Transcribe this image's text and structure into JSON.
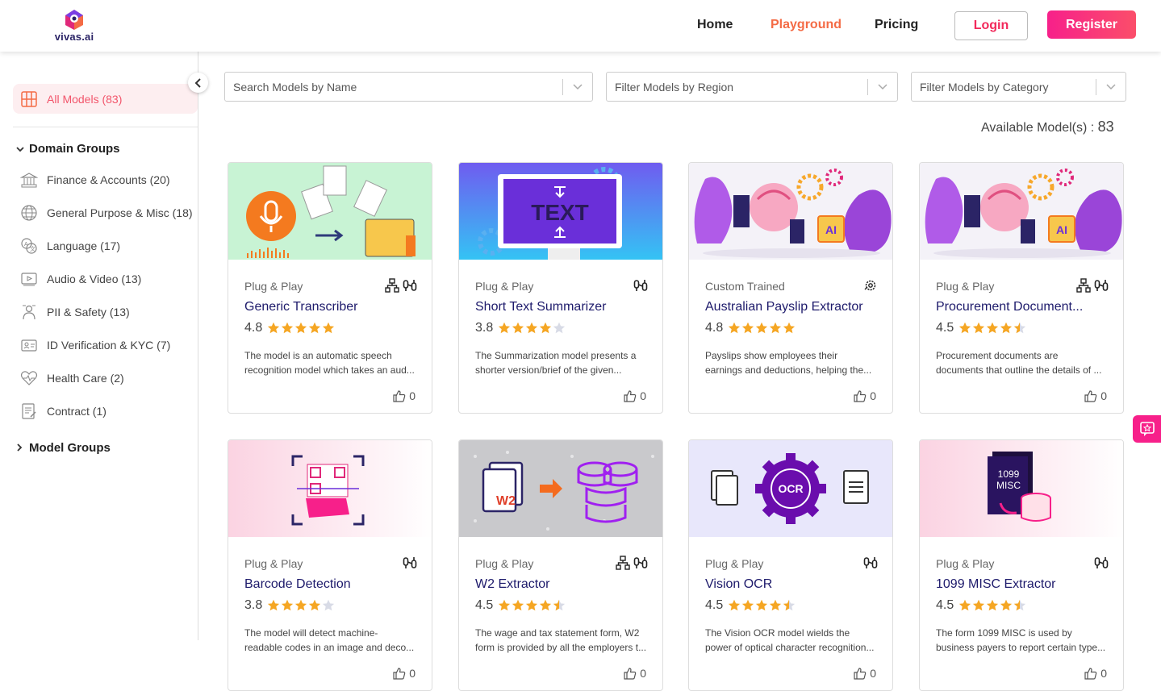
{
  "header": {
    "logo_text": "vivas.ai",
    "nav": [
      "Home",
      "Playground",
      "Pricing"
    ],
    "active_nav": "Playground",
    "login_label": "Login",
    "register_label": "Register"
  },
  "sidebar": {
    "all_models_label": "All Models (83)",
    "domain_groups_label": "Domain Groups",
    "model_groups_label": "Model Groups",
    "items": [
      {
        "label": "Finance & Accounts (20)",
        "icon": "bank-icon"
      },
      {
        "label": "General Purpose & Misc (18)",
        "icon": "globe-icon"
      },
      {
        "label": "Language (17)",
        "icon": "translate-icon"
      },
      {
        "label": "Audio & Video (13)",
        "icon": "video-icon"
      },
      {
        "label": "PII & Safety (13)",
        "icon": "shield-person-icon"
      },
      {
        "label": "ID Verification & KYC (7)",
        "icon": "id-card-icon"
      },
      {
        "label": "Health Care (2)",
        "icon": "heartbeat-icon"
      },
      {
        "label": "Contract (1)",
        "icon": "contract-icon"
      }
    ]
  },
  "filters": {
    "name_placeholder": "Search Models by Name",
    "region_placeholder": "Filter Models by Region",
    "category_placeholder": "Filter Models by Category"
  },
  "available": {
    "label": "Available Model(s) :",
    "count": "83"
  },
  "colors": {
    "accent": "#f46b45",
    "brand_pink": "#f7208a",
    "title_navy": "#1d1a6b",
    "star": "#f5a623"
  },
  "cards": [
    {
      "type": "Plug & Play",
      "title": "Generic Transcriber",
      "rating": "4.8",
      "stars": 5,
      "desc1": "The model is an automatic speech",
      "desc2": "recognition model which takes an aud...",
      "likes": "0",
      "badges": [
        "sitemap-icon",
        "api-icon"
      ]
    },
    {
      "type": "Plug & Play",
      "title": "Short Text Summarizer",
      "rating": "3.8",
      "stars": 4,
      "desc1": "The Summarization model presents a",
      "desc2": "shorter version/brief of the given...",
      "likes": "0",
      "badges": [
        "api-icon"
      ]
    },
    {
      "type": "Custom Trained",
      "title": "Australian Payslip Extractor",
      "rating": "4.8",
      "stars": 5,
      "desc1": "Payslips show employees their",
      "desc2": "earnings and deductions, helping the...",
      "likes": "0",
      "badges": [
        "gear-icon"
      ]
    },
    {
      "type": "Plug & Play",
      "title": "Procurement Document...",
      "rating": "4.5",
      "stars": 4.5,
      "desc1": "Procurement documents are",
      "desc2": "documents that outline the details of ...",
      "likes": "0",
      "badges": [
        "sitemap-icon",
        "api-icon"
      ]
    },
    {
      "type": "Plug & Play",
      "title": "Barcode Detection",
      "rating": "3.8",
      "stars": 4,
      "desc1": "The model will detect machine-",
      "desc2": "readable codes in an image and deco...",
      "likes": "0",
      "badges": [
        "api-icon"
      ]
    },
    {
      "type": "Plug & Play",
      "title": "W2 Extractor",
      "rating": "4.5",
      "stars": 4.5,
      "desc1": "The wage and tax statement form, W2",
      "desc2": "form is provided by all the employers t...",
      "likes": "0",
      "badges": [
        "sitemap-icon",
        "api-icon"
      ]
    },
    {
      "type": "Plug & Play",
      "title": "Vision OCR",
      "rating": "4.5",
      "stars": 4.5,
      "desc1": "The Vision OCR model wields the",
      "desc2": "power of optical character recognition...",
      "likes": "0",
      "badges": [
        "api-icon"
      ]
    },
    {
      "type": "Plug & Play",
      "title": "1099 MISC Extractor",
      "rating": "4.5",
      "stars": 4.5,
      "desc1": "The form 1099 MISC is used by",
      "desc2": "business payers to report certain type...",
      "likes": "0",
      "badges": [
        "api-icon"
      ]
    }
  ],
  "thumb_text": {
    "text_banner": "TEXT",
    "w2": "W2",
    "ocr": "OCR",
    "ai": "AI",
    "misc": "1099\nMISC"
  }
}
